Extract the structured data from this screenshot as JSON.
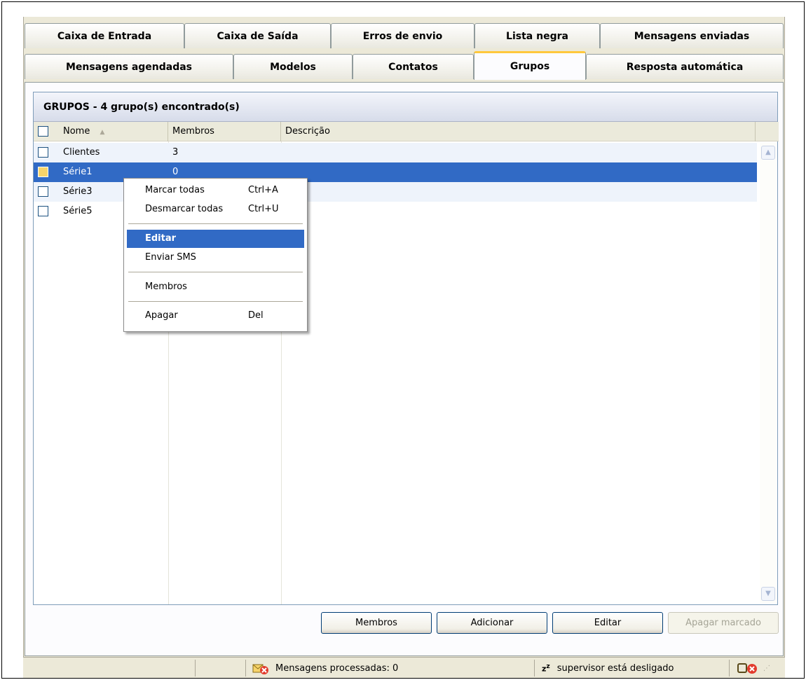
{
  "tabs_row1": [
    {
      "label": "Caixa de Entrada",
      "w": 228
    },
    {
      "label": "Caixa de Saída",
      "w": 209
    },
    {
      "label": "Erros de envio",
      "w": 205
    },
    {
      "label": "Lista negra",
      "w": 179
    },
    {
      "label": "Mensagens enviadas",
      "w": 262
    }
  ],
  "tabs_row2": [
    {
      "label": "Mensagens agendadas",
      "w": 298
    },
    {
      "label": "Modelos",
      "w": 170
    },
    {
      "label": "Contatos",
      "w": 173
    },
    {
      "label": "Grupos",
      "w": 160
    },
    {
      "label": "Resposta automática",
      "w": 282
    }
  ],
  "active_tab": "Grupos",
  "panel_title": "GRUPOS - 4 grupo(s) encontrado(s)",
  "columns": {
    "name": "Nome",
    "members": "Membros",
    "description": "Descrição"
  },
  "rows": [
    {
      "name": "Clientes",
      "members": "3",
      "description": "",
      "selected": false
    },
    {
      "name": "Série1",
      "members": "0",
      "description": "",
      "selected": true
    },
    {
      "name": "Série3",
      "members": "",
      "description": "",
      "selected": false
    },
    {
      "name": "Série5",
      "members": "",
      "description": "",
      "selected": false
    }
  ],
  "context_menu": {
    "mark_all": "Marcar todas",
    "mark_all_shortcut": "Ctrl+A",
    "unmark_all": "Desmarcar todas",
    "unmark_all_shortcut": "Ctrl+U",
    "edit": "Editar",
    "send_sms": "Enviar SMS",
    "members": "Membros",
    "delete": "Apagar",
    "delete_shortcut": "Del"
  },
  "buttons": {
    "members": "Membros",
    "add": "Adicionar",
    "edit": "Editar",
    "delete_marked": "Apagar marcado"
  },
  "status": {
    "processed": "Mensagens processadas: 0",
    "supervisor": "supervisor está desligado"
  },
  "colors": {
    "selection": "#316ac5",
    "active_tab_accent": "#ffc83c"
  }
}
